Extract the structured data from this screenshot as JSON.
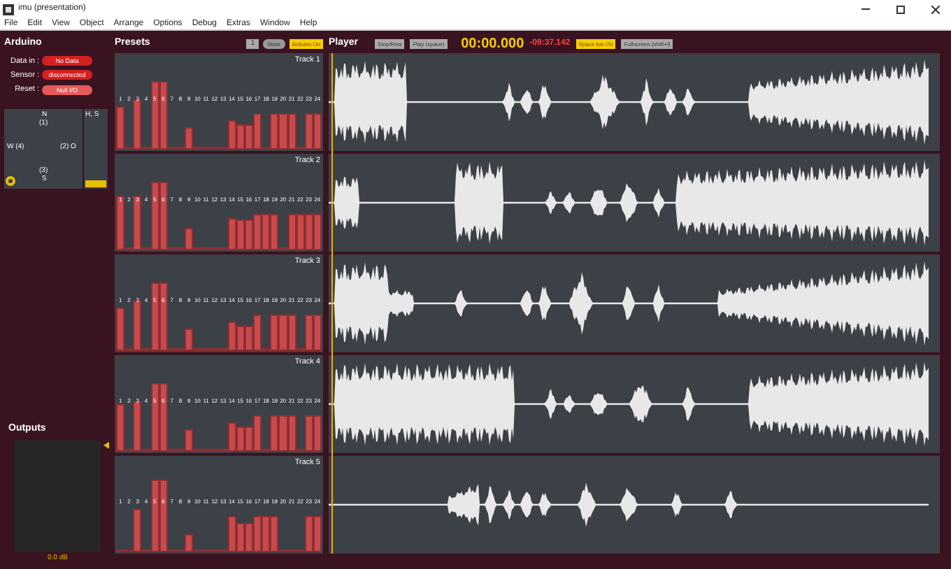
{
  "window": {
    "title": "imu (presentation)"
  },
  "menu": [
    "File",
    "Edit",
    "View",
    "Object",
    "Arrange",
    "Options",
    "Debug",
    "Extras",
    "Window",
    "Help"
  ],
  "arduino": {
    "title": "Arduino",
    "rows": [
      {
        "label": "Data in :",
        "value": "No Data",
        "color": "#d42020"
      },
      {
        "label": "Sensor :",
        "value": "disconnected",
        "color": "#d42020"
      },
      {
        "label": "Reset :",
        "value": "Null I/O",
        "color": "#e65a5a"
      }
    ],
    "compass": {
      "north": "N",
      "north_index": "(1)",
      "west": "W (4)",
      "east": "(2) O",
      "south_index": "(3)",
      "south": "S"
    },
    "side_slider": {
      "label": "H, S",
      "level": 0.1
    }
  },
  "outputs": {
    "title": "Outputs",
    "reading": "0.0 dB"
  },
  "presets": {
    "title": "Presets",
    "preset_number": "1",
    "store": "Store",
    "arduino_toggle": {
      "label": "Arduino On",
      "on": true
    },
    "tracks": [
      {
        "name": "Track 1",
        "bars": [
          {
            "label": "1",
            "level": 0.6
          },
          {
            "label": "2",
            "level": 0.03
          },
          {
            "label": "3",
            "level": 0.7
          },
          {
            "label": "4",
            "level": 0.03
          },
          {
            "label": "5",
            "level": 0.95
          },
          {
            "label": "6",
            "level": 0.95
          },
          {
            "label": "7",
            "level": 0.03
          },
          {
            "label": "8",
            "level": 0.03
          },
          {
            "label": "9",
            "level": 0.3
          },
          {
            "label": "10",
            "level": 0.03
          },
          {
            "label": "11",
            "level": 0.03
          },
          {
            "label": "12",
            "level": 0.03
          },
          {
            "label": "13",
            "level": 0.03
          },
          {
            "label": "14",
            "level": 0.4
          },
          {
            "label": "15",
            "level": 0.35
          },
          {
            "label": "16",
            "level": 0.35
          },
          {
            "label": "17",
            "level": 0.5
          },
          {
            "label": "18",
            "level": 0.03
          },
          {
            "label": "19",
            "level": 0.5
          },
          {
            "label": "20",
            "level": 0.5
          },
          {
            "label": "21",
            "level": 0.5
          },
          {
            "label": "22",
            "level": 0.03
          },
          {
            "label": "23",
            "level": 0.5
          },
          {
            "label": "24",
            "level": 0.5
          }
        ]
      },
      {
        "name": "Track 2",
        "bars": [
          {
            "label": "1",
            "level": 0.75
          },
          {
            "label": "2",
            "level": 0.03
          },
          {
            "label": "3",
            "level": 0.75
          },
          {
            "label": "4",
            "level": 0.03
          },
          {
            "label": "5",
            "level": 0.95
          },
          {
            "label": "6",
            "level": 0.95
          },
          {
            "label": "7",
            "level": 0.03
          },
          {
            "label": "8",
            "level": 0.03
          },
          {
            "label": "9",
            "level": 0.3
          },
          {
            "label": "10",
            "level": 0.03
          },
          {
            "label": "11",
            "level": 0.03
          },
          {
            "label": "12",
            "level": 0.03
          },
          {
            "label": "13",
            "level": 0.03
          },
          {
            "label": "14",
            "level": 0.45
          },
          {
            "label": "15",
            "level": 0.43
          },
          {
            "label": "16",
            "level": 0.43
          },
          {
            "label": "17",
            "level": 0.5
          },
          {
            "label": "18",
            "level": 0.5
          },
          {
            "label": "19",
            "level": 0.5
          },
          {
            "label": "20",
            "level": 0.03
          },
          {
            "label": "21",
            "level": 0.5
          },
          {
            "label": "22",
            "level": 0.5
          },
          {
            "label": "23",
            "level": 0.5
          },
          {
            "label": "24",
            "level": 0.5
          }
        ]
      },
      {
        "name": "Track 3",
        "bars": [
          {
            "label": "1",
            "level": 0.6
          },
          {
            "label": "2",
            "level": 0.03
          },
          {
            "label": "3",
            "level": 0.7
          },
          {
            "label": "4",
            "level": 0.03
          },
          {
            "label": "5",
            "level": 0.95
          },
          {
            "label": "6",
            "level": 0.95
          },
          {
            "label": "7",
            "level": 0.03
          },
          {
            "label": "8",
            "level": 0.03
          },
          {
            "label": "9",
            "level": 0.3
          },
          {
            "label": "10",
            "level": 0.03
          },
          {
            "label": "11",
            "level": 0.03
          },
          {
            "label": "12",
            "level": 0.03
          },
          {
            "label": "13",
            "level": 0.03
          },
          {
            "label": "14",
            "level": 0.4
          },
          {
            "label": "15",
            "level": 0.35
          },
          {
            "label": "16",
            "level": 0.35
          },
          {
            "label": "17",
            "level": 0.5
          },
          {
            "label": "18",
            "level": 0.03
          },
          {
            "label": "19",
            "level": 0.5
          },
          {
            "label": "20",
            "level": 0.5
          },
          {
            "label": "21",
            "level": 0.5
          },
          {
            "label": "22",
            "level": 0.03
          },
          {
            "label": "23",
            "level": 0.5
          },
          {
            "label": "24",
            "level": 0.5
          }
        ]
      },
      {
        "name": "Track 4",
        "bars": [
          {
            "label": "1",
            "level": 0.65
          },
          {
            "label": "2",
            "level": 0.03
          },
          {
            "label": "3",
            "level": 0.7
          },
          {
            "label": "4",
            "level": 0.03
          },
          {
            "label": "5",
            "level": 0.95
          },
          {
            "label": "6",
            "level": 0.95
          },
          {
            "label": "7",
            "level": 0.03
          },
          {
            "label": "8",
            "level": 0.03
          },
          {
            "label": "9",
            "level": 0.3
          },
          {
            "label": "10",
            "level": 0.03
          },
          {
            "label": "11",
            "level": 0.03
          },
          {
            "label": "12",
            "level": 0.03
          },
          {
            "label": "13",
            "level": 0.03
          },
          {
            "label": "14",
            "level": 0.4
          },
          {
            "label": "15",
            "level": 0.35
          },
          {
            "label": "16",
            "level": 0.35
          },
          {
            "label": "17",
            "level": 0.5
          },
          {
            "label": "18",
            "level": 0.03
          },
          {
            "label": "19",
            "level": 0.5
          },
          {
            "label": "20",
            "level": 0.5
          },
          {
            "label": "21",
            "level": 0.5
          },
          {
            "label": "22",
            "level": 0.03
          },
          {
            "label": "23",
            "level": 0.5
          },
          {
            "label": "24",
            "level": 0.5
          }
        ]
      },
      {
        "name": "Track 5",
        "bars": [
          {
            "label": "1",
            "level": 0.03
          },
          {
            "label": "2",
            "level": 0.03
          },
          {
            "label": "3",
            "level": 0.6
          },
          {
            "label": "4",
            "level": 0.03
          },
          {
            "label": "5",
            "level": 1
          },
          {
            "label": "6",
            "level": 1
          },
          {
            "label": "7",
            "level": 0.03
          },
          {
            "label": "8",
            "level": 0.03
          },
          {
            "label": "9",
            "level": 0.25
          },
          {
            "label": "10",
            "level": 0.03
          },
          {
            "label": "11",
            "level": 0.03
          },
          {
            "label": "12",
            "level": 0.03
          },
          {
            "label": "13",
            "level": 0.03
          },
          {
            "label": "14",
            "level": 0.5
          },
          {
            "label": "15",
            "level": 0.4
          },
          {
            "label": "16",
            "level": 0.4
          },
          {
            "label": "17",
            "level": 0.5
          },
          {
            "label": "18",
            "level": 0.5
          },
          {
            "label": "19",
            "level": 0.5
          },
          {
            "label": "20",
            "level": 0.03
          },
          {
            "label": "21",
            "level": 0.03
          },
          {
            "label": "22",
            "level": 0.03
          },
          {
            "label": "23",
            "level": 0.5
          },
          {
            "label": "24",
            "level": 0.5
          }
        ]
      }
    ]
  },
  "player": {
    "title": "Player",
    "stop": "Stop/Rew",
    "play": "Play (space)",
    "time": "00:00.000",
    "remaining": "-09:37.142",
    "spacebar_toggle": {
      "label": "Space bar On",
      "on": true
    },
    "fullscreen": "Fullscreen (shift+f)",
    "lanes": [
      {
        "kind": "waveform"
      },
      {
        "kind": "waveform"
      },
      {
        "kind": "waveform"
      },
      {
        "kind": "waveform"
      },
      {
        "kind": "waveform"
      }
    ]
  }
}
